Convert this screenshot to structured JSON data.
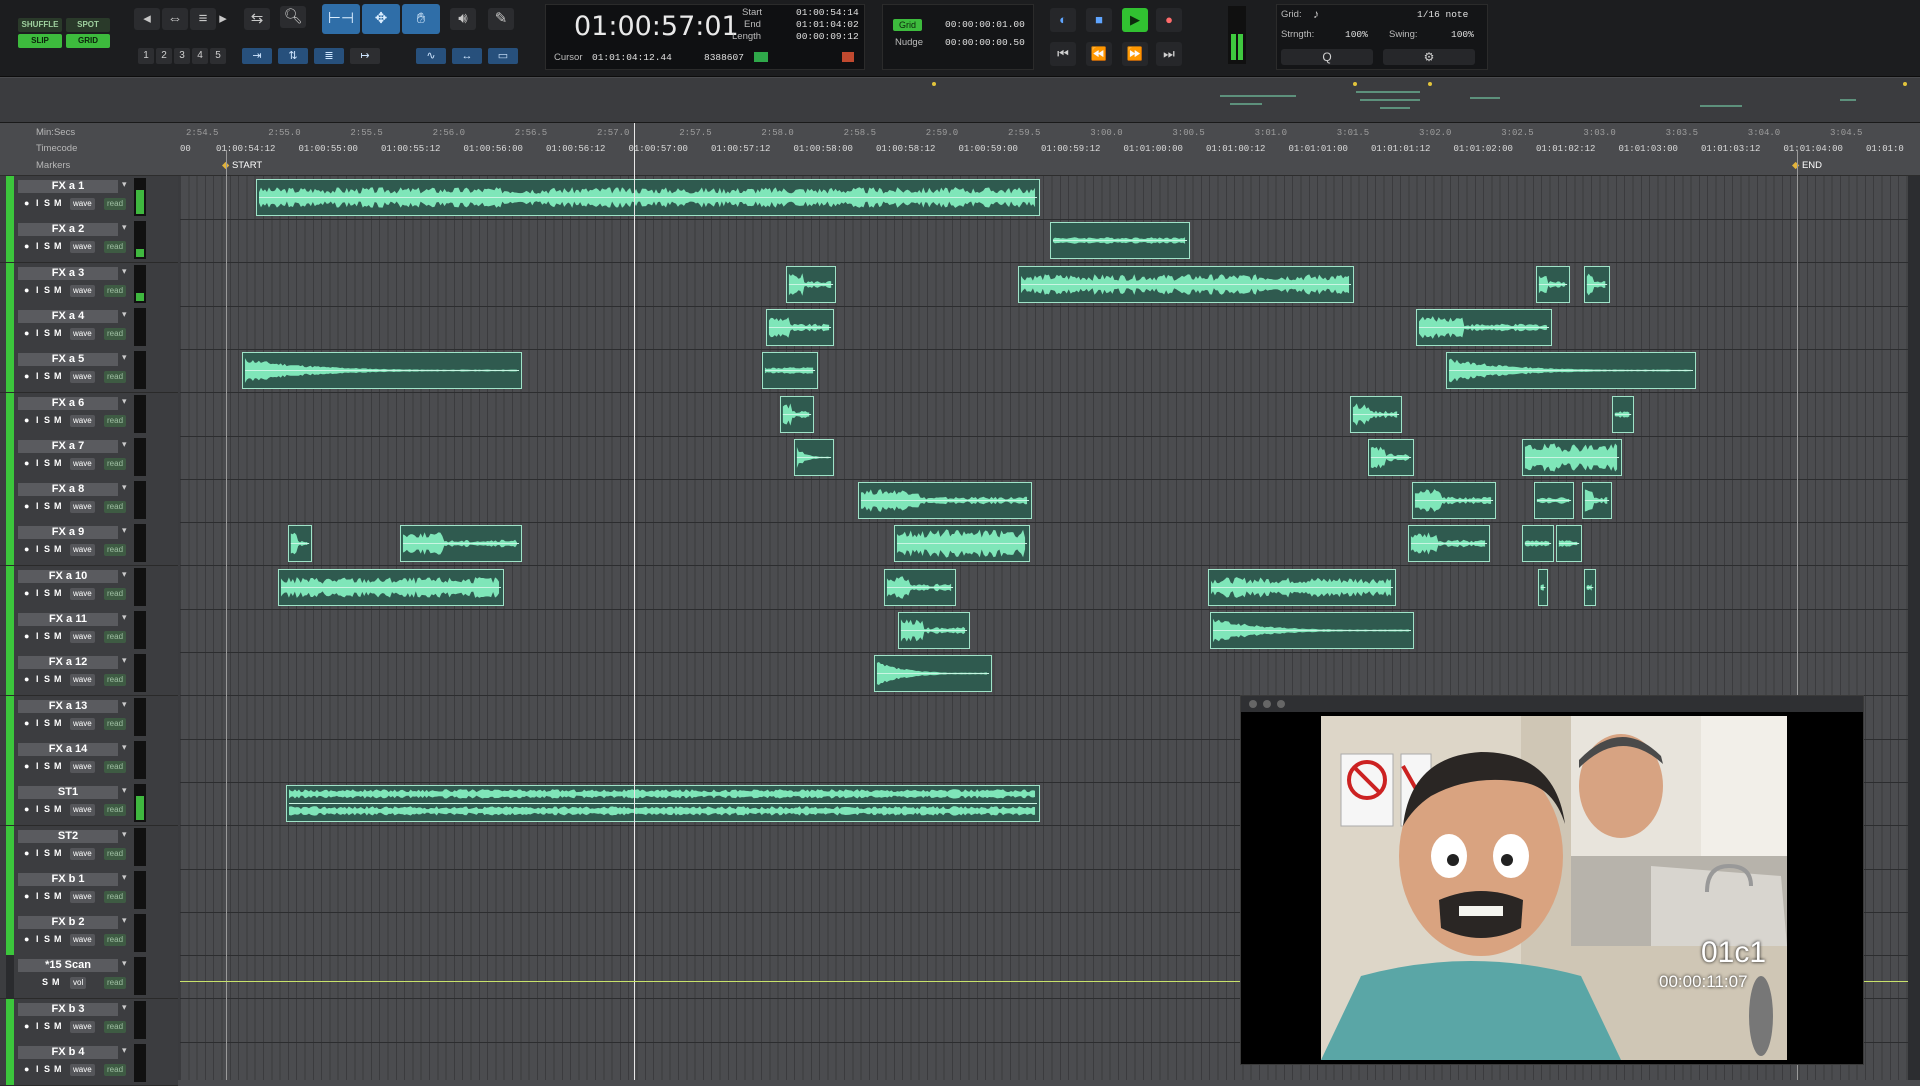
{
  "modes": {
    "shuffle": "SHUFFLE",
    "spot": "SPOT",
    "slip": "SLIP",
    "grid": "GRID"
  },
  "zoom_presets": [
    "1",
    "2",
    "3",
    "4",
    "5"
  ],
  "counter": {
    "main": "01:00:57:01",
    "start_label": "Start",
    "start": "01:00:54:14",
    "end_label": "End",
    "end": "01:01:04:02",
    "length_label": "Length",
    "length": "00:00:09:12",
    "cursor_label": "Cursor",
    "cursor": "01:01:04:12.44",
    "samples": "8388607"
  },
  "grid_nudge": {
    "grid_label": "Grid",
    "grid_value": "00:00:00:01.00",
    "nudge_label": "Nudge",
    "nudge_value": "00:00:00:00.50"
  },
  "quantize": {
    "grid_label": "Grid:",
    "note": "1/16 note",
    "strength_label": "Strngth:",
    "strength": "100%",
    "swing_label": "Swing:",
    "swing": "100%"
  },
  "rulers": {
    "minsecs_label": "Min:Secs",
    "timecode_label": "Timecode",
    "markers_label": "Markers",
    "minsecs_ticks": [
      "2:54.5",
      "2:55.0",
      "2:55.5",
      "2:56.0",
      "2:56.5",
      "2:57.0",
      "2:57.5",
      "2:58.0",
      "2:58.5",
      "2:59.0",
      "2:59.5",
      "3:00.0",
      "3:00.5",
      "3:01.0",
      "3:01.5",
      "3:02.0",
      "3:02.5",
      "3:03.0",
      "3:03.5",
      "3:04.0",
      "3:04.5"
    ],
    "timecode_ticks": [
      "01:00:54:12",
      "01:00:55:00",
      "01:00:55:12",
      "01:00:56:00",
      "01:00:56:12",
      "01:00:57:00",
      "01:00:57:12",
      "01:00:58:00",
      "01:00:58:12",
      "01:00:59:00",
      "01:00:59:12",
      "01:01:00:00",
      "01:01:00:12",
      "01:01:01:00",
      "01:01:01:12",
      "01:01:02:00",
      "01:01:02:12",
      "01:01:03:00",
      "01:01:03:12",
      "01:01:04:00",
      "01:01:0"
    ],
    "timecode_first_partial": "00",
    "marker_start": "START",
    "marker_end": "END"
  },
  "track_buttons": {
    "input": "I",
    "solo": "S",
    "mute": "M",
    "view": "wave",
    "auto": "read",
    "view_vol": "vol"
  },
  "tracks": [
    {
      "name": "FX a 1"
    },
    {
      "name": "FX a 2"
    },
    {
      "name": "FX a 3"
    },
    {
      "name": "FX a 4"
    },
    {
      "name": "FX a 5"
    },
    {
      "name": "FX a 6"
    },
    {
      "name": "FX a 7"
    },
    {
      "name": "FX a 8"
    },
    {
      "name": "FX a 9"
    },
    {
      "name": "FX a 10"
    },
    {
      "name": "FX a 11"
    },
    {
      "name": "FX a 12"
    },
    {
      "name": "FX a 13"
    },
    {
      "name": "FX a 14"
    },
    {
      "name": "ST1"
    },
    {
      "name": "ST2"
    },
    {
      "name": "FX b 1"
    },
    {
      "name": "FX b 2"
    },
    {
      "name": "*15 Scan"
    },
    {
      "name": "FX b 3"
    },
    {
      "name": "FX b 4"
    }
  ],
  "video": {
    "scene": "01c1",
    "timecode": "00:00:11:07"
  },
  "colors": {
    "accent_green": "#3cc63c",
    "clip_fill": "#2f5a4f",
    "waveform": "#7fe6b9",
    "transport_play": "#31c131"
  }
}
